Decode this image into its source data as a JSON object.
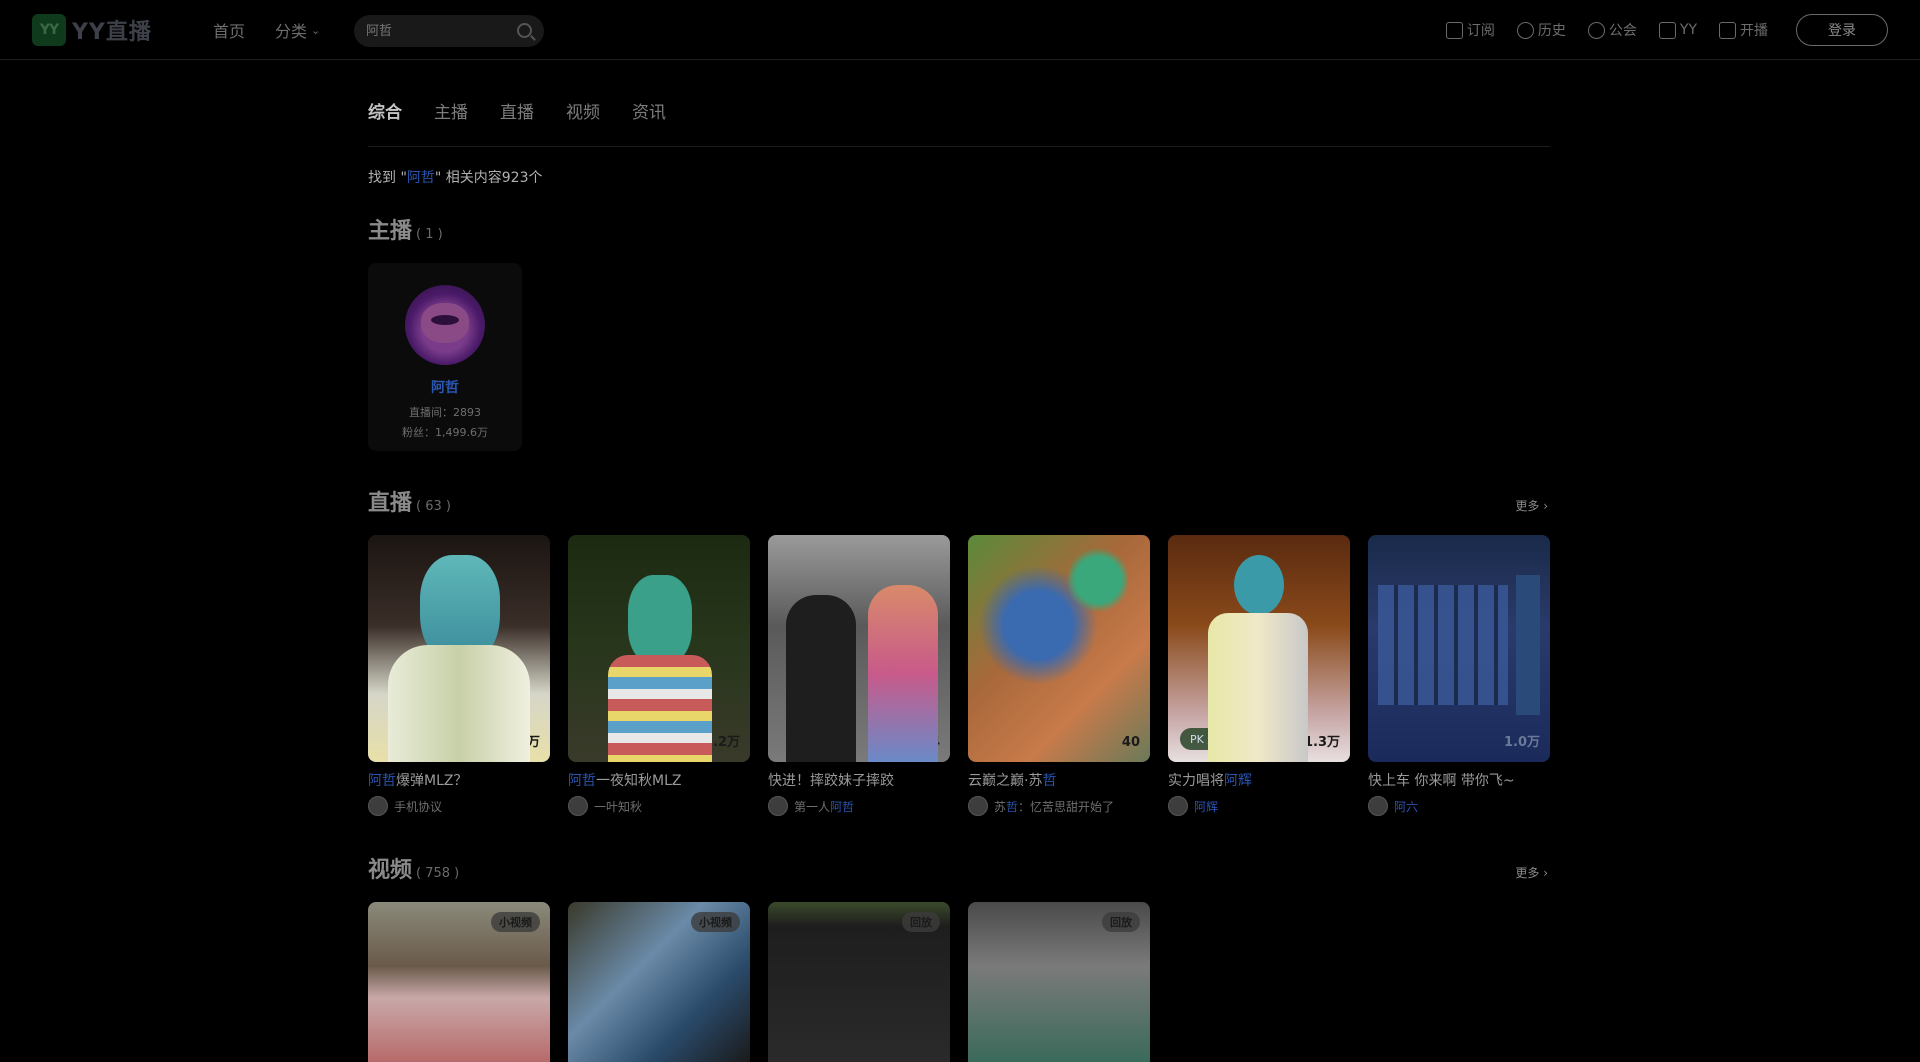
{
  "header": {
    "logo_mark": "YY",
    "logo_text": "YY直播",
    "nav": {
      "home": "首页",
      "category": "分类"
    },
    "search": {
      "placeholder": "阿哲"
    },
    "right": [
      {
        "label": "订阅",
        "icon": "subscribe-icon"
      },
      {
        "label": "历史",
        "icon": "history-icon"
      },
      {
        "label": "公会",
        "icon": "guild-icon"
      },
      {
        "label": "YY",
        "icon": "yy-icon"
      },
      {
        "label": "开播",
        "icon": "broadcast-icon"
      }
    ],
    "login": "登录"
  },
  "tabs": [
    "综合",
    "主播",
    "直播",
    "视频",
    "资讯"
  ],
  "found": {
    "prefix": "找到 \"",
    "keyword": "阿哲",
    "suffix": "\" 相关内容923个"
  },
  "streamers": {
    "title": "主播",
    "count": "( 1 )",
    "items": [
      {
        "name": "阿哲",
        "room": "直播间：2893",
        "fans": "粉丝：1,499.6万"
      }
    ]
  },
  "live": {
    "title": "直播",
    "count": "( 63 )",
    "more": "更多",
    "items": [
      {
        "title_kw": "阿哲",
        "title_rest": "爆弹MLZ？",
        "viewers": "13.4万",
        "anchor": "手机协议",
        "anchor_kw": ""
      },
      {
        "title_kw": "阿哲",
        "title_rest": "一夜知秋MLZ",
        "viewers": "1.2万",
        "anchor": "一叶知秋",
        "anchor_kw": ""
      },
      {
        "title_kw": "",
        "title_rest": "快进！摔跤妹子摔跤",
        "viewers": "3904",
        "anchor": "第一人",
        "anchor_kw": "阿哲"
      },
      {
        "title_kw": "",
        "title_rest": "云巅之巅·苏",
        "title_kw_end": "哲",
        "viewers": "40",
        "anchor": "：忆苦思甜开始了",
        "anchor_pre": "苏",
        "anchor_kw": "哲"
      },
      {
        "title_kw": "",
        "title_rest": "实力唱将",
        "title_kw_end": "阿辉",
        "viewers": "1.3万",
        "badge": "PK 连麦",
        "anchor": "",
        "anchor_kw": "阿辉"
      },
      {
        "title_kw": "",
        "title_rest": "快上车 你来啊 带你飞~",
        "viewers": "1.0万",
        "anchor": "",
        "anchor_kw": "阿六"
      }
    ]
  },
  "videos": {
    "title": "视频",
    "count": "( 758 )",
    "more": "更多",
    "items": [
      {
        "tag": "小视频"
      },
      {
        "tag": "小视频"
      },
      {
        "tag": "回放"
      },
      {
        "tag": "回放"
      }
    ]
  },
  "colors": {
    "background": "#000000",
    "keyword": "#2a55b0",
    "text": "#c8c8c8"
  }
}
